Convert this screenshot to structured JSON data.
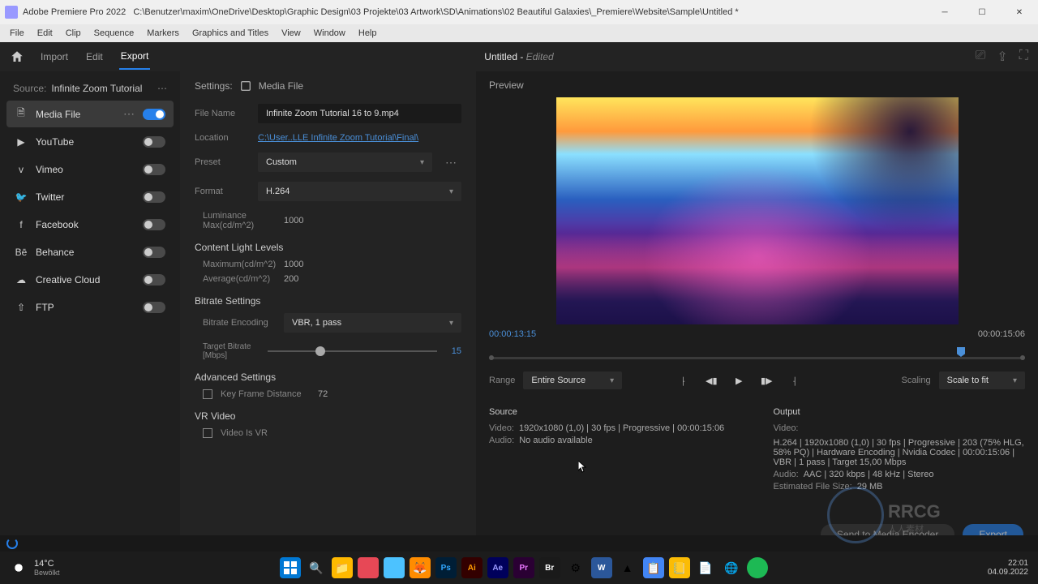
{
  "titlebar": {
    "app": "Adobe Premiere Pro 2022",
    "path": "C:\\Benutzer\\maxim\\OneDrive\\Desktop\\Graphic Design\\03 Projekte\\03 Artwork\\SD\\Animations\\02 Beautiful Galaxies\\_Premiere\\Website\\Sample\\Untitled *"
  },
  "menu": [
    "File",
    "Edit",
    "Clip",
    "Sequence",
    "Markers",
    "Graphics and Titles",
    "View",
    "Window",
    "Help"
  ],
  "nav": {
    "import": "Import",
    "edit": "Edit",
    "export": "Export"
  },
  "doc": {
    "name": "Untitled",
    "state": "Edited"
  },
  "source": {
    "label": "Source:",
    "value": "Infinite Zoom Tutorial"
  },
  "destinations": [
    {
      "icon": "media",
      "label": "Media File",
      "active": true,
      "on": true,
      "opts": true
    },
    {
      "icon": "youtube",
      "label": "YouTube",
      "on": false
    },
    {
      "icon": "vimeo",
      "label": "Vimeo",
      "on": false
    },
    {
      "icon": "twitter",
      "label": "Twitter",
      "on": false
    },
    {
      "icon": "facebook",
      "label": "Facebook",
      "on": false
    },
    {
      "icon": "behance",
      "label": "Behance",
      "on": false
    },
    {
      "icon": "cloud",
      "label": "Creative Cloud",
      "on": false
    },
    {
      "icon": "ftp",
      "label": "FTP",
      "on": false
    }
  ],
  "settings": {
    "header": "Settings:",
    "dest": "Media File",
    "filename_l": "File Name",
    "filename": "Infinite Zoom Tutorial 16 to 9.mp4",
    "location_l": "Location",
    "location": "C:\\User..LLE Infinite Zoom Tutorial\\Final\\",
    "preset_l": "Preset",
    "preset": "Custom",
    "format_l": "Format",
    "format": "H.264",
    "lum_l": "Luminance Max(cd/m^2)",
    "lum": "1000",
    "cll_hdr": "Content Light Levels",
    "maxcll_l": "Maximum(cd/m^2)",
    "maxcll": "1000",
    "avgcll_l": "Average(cd/m^2)",
    "avgcll": "200",
    "bitrate_hdr": "Bitrate Settings",
    "benc_l": "Bitrate Encoding",
    "benc": "VBR, 1 pass",
    "tbr_l": "Target Bitrate [Mbps]",
    "tbr": "15",
    "adv_hdr": "Advanced Settings",
    "kfd_l": "Key Frame Distance",
    "kfd": "72",
    "vr_hdr": "VR Video",
    "vr_l": "Video Is VR"
  },
  "preview": {
    "label": "Preview",
    "cur": "00:00:13:15",
    "dur": "00:00:15:06",
    "range_l": "Range",
    "range": "Entire Source",
    "scaling_l": "Scaling",
    "scaling": "Scale to fit"
  },
  "source_info": {
    "hdr": "Source",
    "video_l": "Video:",
    "video": "1920x1080 (1,0) | 30 fps | Progressive | 00:00:15:06",
    "audio_l": "Audio:",
    "audio": "No audio available"
  },
  "output_info": {
    "hdr": "Output",
    "video_l": "Video:",
    "video": "H.264 | 1920x1080 (1,0) | 30 fps | Progressive | 203 (75% HLG, 58% PQ) | Hardware Encoding | Nvidia Codec | 00:00:15:06 | VBR | 1 pass | Target 15,00 Mbps",
    "audio_l": "Audio:",
    "audio": "AAC | 320 kbps | 48 kHz | Stereo",
    "est_l": "Estimated File Size:",
    "est": "29 MB"
  },
  "buttons": {
    "send": "Send to Media Encoder",
    "export": "Export"
  },
  "taskbar": {
    "temp": "14°C",
    "cond": "Bewölkt",
    "time": "22:01",
    "date": "04.09.2022"
  }
}
